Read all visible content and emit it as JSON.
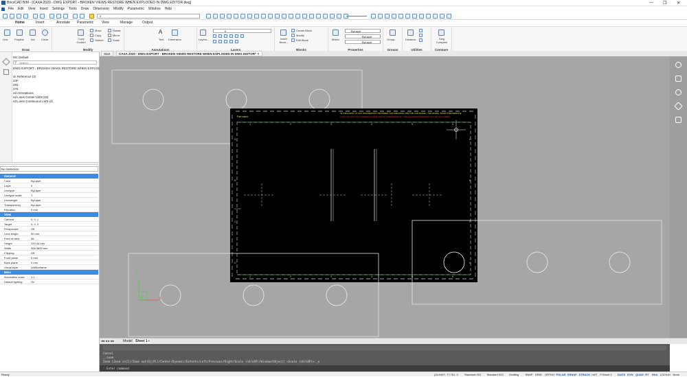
{
  "window": {
    "title": "BricsCAD BIM - [CAXA 2020 - DWG EXPORT - BROKEN VIEWS RESTORE WHEN EXPLODED IN DWG EDITOR.dwg]",
    "controls": {
      "minimize": "—",
      "maximize": "❐",
      "close": "✕"
    }
  },
  "menubar": [
    "File",
    "Edit",
    "View",
    "Insert",
    "Settings",
    "Tools",
    "Draw",
    "Dimension",
    "Modify",
    "Parametric",
    "Window",
    "Help"
  ],
  "toolbar": {
    "layer_value": "0",
    "linetype_value": "0"
  },
  "ribbon_tabs": [
    "Home",
    "Insert",
    "Annotate",
    "Parametric",
    "View",
    "Manage",
    "Output"
  ],
  "ribbon": {
    "draw": {
      "title": "Draw",
      "items": [
        "Line",
        "Polyline",
        "Arc",
        "Circle"
      ]
    },
    "modify": {
      "title": "Modify",
      "big": [
        "Copy Guided"
      ],
      "col1": [
        "Move",
        "Copy",
        "Stretch"
      ],
      "col2": [
        "Rotate",
        "Mirror",
        "Scale"
      ]
    },
    "annotations": {
      "title": "Annotations",
      "items": [
        "Text",
        "Dimension"
      ]
    },
    "layers": {
      "title": "Layers",
      "button": "Layers...",
      "combo": "0"
    },
    "blocks": {
      "title": "Blocks",
      "big": "Insert Block...",
      "items": [
        "Create Block",
        "Modify",
        "Edit Block"
      ]
    },
    "properties": {
      "title": "Properties",
      "big": "Match",
      "combos": [
        "ByLayer",
        "ByLayer",
        "ByLayer"
      ]
    },
    "groups": {
      "title": "Groups",
      "item": "Group..."
    },
    "utilities": {
      "title": "Utilities",
      "item": "Distance"
    },
    "compare": {
      "title": "Compare",
      "item": "Dwg Compare"
    }
  },
  "doc_tabs": [
    "Start",
    "CAXA 2020 - DWG EXPORT - BROKEN VIEWS RESTORE WHEN EXPLODED IN DWG EDITOR*"
  ],
  "structure_panel": {
    "title": "MC Default",
    "search_placeholder": "Search",
    "tree": [
      "DWG EXPORT - BROKEN VIEWS RESTORE WHEN EXPLODED I",
      "",
      "ck Reference (3)",
      "24F",
      "292",
      "275",
      "nd Annotations",
      "nd Lines Center LW3 (19)",
      "nd Lines Continuous LW3 (4)"
    ]
  },
  "properties_panel": {
    "selection": "No Selection",
    "sections": [
      {
        "name": "General",
        "rows": [
          [
            "Color",
            "ByLayer"
          ],
          [
            "Layer",
            "0"
          ],
          [
            "Linetype",
            "ByLayer"
          ],
          [
            "Linetype scale",
            "1"
          ],
          [
            "Lineweight",
            "ByLayer"
          ],
          [
            "Transparency",
            "ByLayer"
          ],
          [
            "Elevation",
            "0 mm"
          ]
        ]
      },
      {
        "name": "View",
        "rows": [
          [
            "Camera",
            "0, 0, 1"
          ],
          [
            "Target",
            "0, 0, 0"
          ],
          [
            "Perspective",
            "Off"
          ],
          [
            "Lens length",
            "50 mm"
          ],
          [
            "Field of view",
            "36"
          ],
          [
            "Height",
            "220.44 mm"
          ],
          [
            "Width",
            "368.3800 mm"
          ],
          [
            "Clipping",
            "Off"
          ],
          [
            "Front plane",
            "0 mm"
          ],
          [
            "Back plane",
            "0 mm"
          ],
          [
            "Visual style",
            "2dWireframe"
          ]
        ]
      },
      {
        "name": "Misc",
        "rows": [
          [
            "Annotation scale",
            "1:1"
          ],
          [
            "Default lighting",
            "On"
          ]
        ]
      }
    ]
  },
  "drawing": {
    "header_left": "Part name",
    "header_red": "IN THE EVENT OF ANY DISCREPANCY BETWEEN THIS DRAWING AND THE CAD MODEL, THE MODEL TAKES PRECEDENCE",
    "header_red2": "THIS CAD UNIT NO LONGER IN ISSUE AND IS SUPERSEDED BY THE ADJACENT DRAWING OR THE FOLLOWING",
    "col_labels": [
      "1",
      "2",
      "3",
      "4",
      "5",
      "6"
    ],
    "row_labels": [
      "A",
      "B",
      "C",
      "D"
    ],
    "ucs": {
      "x": "X",
      "y": "Y",
      "w": "W"
    }
  },
  "layout_tabs": [
    "Model",
    "Sheet 1"
  ],
  "command": {
    "history": [
      "Cancel",
      "_.zoom",
      "Zoom [Zoom in(I)/Zoom out(O)/All/Center/Dynamic/Extents/Left/Previous/Right/Scale (nX/nXP)/Window/Object] <Scale (nX/nXP)>:_e"
    ],
    "prompt": ": Enter command"
  },
  "statusbar": {
    "left": "Ready",
    "coords": "(24.0467, 77.761, 0",
    "items": [
      "Standard ISO",
      "Standard ISO",
      "Drafting",
      "SNAP",
      "GRID",
      "ORTHO",
      "POLAR",
      "ESNAP",
      "STRACK",
      "LWT",
      "P:Sheet 1",
      "DUCS",
      "DYN",
      "QUAD",
      "RT",
      "HKA",
      "LOCKUI",
      "None"
    ],
    "on": [
      "POLAR",
      "ESNAP",
      "STRACK",
      "DUCS",
      "DYN",
      "QUAD",
      "RT",
      "HKA"
    ]
  }
}
